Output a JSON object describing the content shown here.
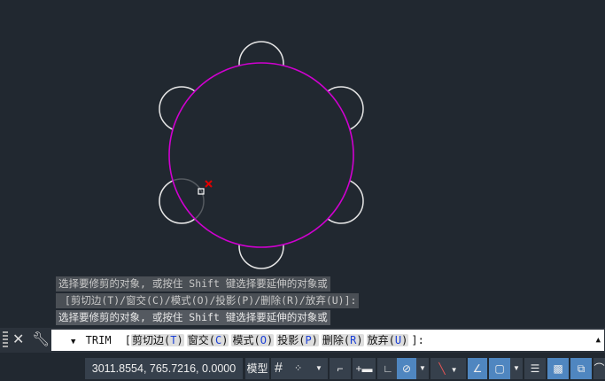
{
  "drawing": {
    "main_circle_color": "#d000d0",
    "small_circle_color": "#e6e6e6",
    "pick_marker_color": "#e00000"
  },
  "history": [
    "选择要修剪的对象, 或按住 Shift 键选择要延伸的对象或",
    " [剪切边(T)/窗交(C)/模式(O)/投影(P)/删除(R)/放弃(U)]:",
    "选择要修剪的对象, 或按住 Shift 键选择要延伸的对象或"
  ],
  "command": {
    "name": "TRIM",
    "options": [
      {
        "label": "剪切边",
        "key": "T"
      },
      {
        "label": "窗交",
        "key": "C"
      },
      {
        "label": "模式",
        "key": "O"
      },
      {
        "label": "投影",
        "key": "P"
      },
      {
        "label": "删除",
        "key": "R"
      },
      {
        "label": "放弃",
        "key": "U"
      }
    ],
    "suffix": "]:"
  },
  "status": {
    "coordinates": "3011.8554, 765.7216, 0.0000",
    "model_label": "模型",
    "toggles": [
      {
        "name": "grid",
        "on": false
      },
      {
        "name": "snap",
        "on": false
      },
      {
        "name": "infer",
        "on": false
      },
      {
        "name": "dynamic-input",
        "on": false
      },
      {
        "name": "ortho",
        "on": false
      },
      {
        "name": "polar",
        "on": true
      },
      {
        "name": "isometric",
        "on": false
      },
      {
        "name": "object-snap-tracking",
        "on": true
      },
      {
        "name": "object-snap",
        "on": true
      },
      {
        "name": "lineweight",
        "on": false
      },
      {
        "name": "transparency",
        "on": true
      },
      {
        "name": "selection-cycling",
        "on": true
      }
    ]
  }
}
